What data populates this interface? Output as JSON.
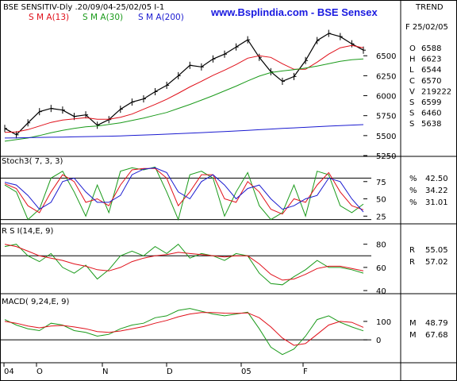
{
  "header": {
    "title": "BSE SENSITIV-Dly .20/09/04-25/02/05  I-1",
    "site": "www.Bsplindia.com - BSE Sensex",
    "trend_label": "TREND",
    "sma_labels": [
      "S M A(13)",
      "S M A(30)",
      "S M A(200)"
    ],
    "sma_colors": [
      "#e0101a",
      "#1a9a1a",
      "#1a1ad0"
    ]
  },
  "info_panel": {
    "date": "F 25/02/05",
    "rows": [
      {
        "key": "O",
        "value": "6588",
        "color": "#000000"
      },
      {
        "key": "H",
        "value": "6623",
        "color": "#9a8a00"
      },
      {
        "key": "L",
        "value": "6544",
        "color": "#9a8a00"
      },
      {
        "key": "C",
        "value": "6570",
        "color": "#9a8a00"
      },
      {
        "key": "V",
        "value": "219222",
        "color": "#000000"
      },
      {
        "key": "S",
        "value": "6599",
        "color": "#e0101a"
      },
      {
        "key": "S",
        "value": "6460",
        "color": "#1a9a1a"
      },
      {
        "key": "S",
        "value": "5638",
        "color": "#1a1ad0"
      }
    ]
  },
  "stoch_panel": {
    "label": "Stoch3( 7, 3, 3)",
    "readings": [
      {
        "key": "%",
        "value": "42.50",
        "color": "#1a9a1a"
      },
      {
        "key": "%",
        "value": "34.22",
        "color": "#e0101a"
      },
      {
        "key": "%",
        "value": "31.01",
        "color": "#1a1ad0"
      }
    ]
  },
  "rsi_panel": {
    "label": "R S I(14,E, 9)",
    "readings": [
      {
        "key": "R",
        "value": "55.05",
        "color": "#1a9a1a"
      },
      {
        "key": "R",
        "value": "57.02",
        "color": "#e0101a"
      }
    ]
  },
  "macd_panel": {
    "label": "MACD( 9,24,E, 9)",
    "readings": [
      {
        "key": "M",
        "value": "48.79",
        "color": "#1a9a1a"
      },
      {
        "key": "M",
        "value": "67.68",
        "color": "#e0101a"
      }
    ]
  },
  "x_axis": {
    "labels": [
      "04",
      "O",
      "N",
      "D",
      "05",
      "F"
    ]
  },
  "chart_data": [
    {
      "type": "line",
      "name": "price",
      "title": "BSE SENSITIV-Dly .20/09/04-25/02/05  I-1",
      "ylim": [
        5250,
        6900
      ],
      "y_ticks": [
        5250,
        5500,
        5750,
        6000,
        6250,
        6500
      ],
      "x": [
        "Sep-20",
        "Sep-24",
        "Sep-29",
        "Oct-04",
        "Oct-08",
        "Oct-14",
        "Oct-19",
        "Oct-25",
        "Oct-29",
        "Nov-03",
        "Nov-09",
        "Nov-15",
        "Nov-19",
        "Nov-25",
        "Nov-30",
        "Dec-06",
        "Dec-10",
        "Dec-16",
        "Dec-21",
        "Dec-27",
        "Dec-31",
        "Jan-05",
        "Jan-10",
        "Jan-14",
        "Jan-19",
        "Jan-24",
        "Jan-28",
        "Feb-02",
        "Feb-08",
        "Feb-14",
        "Feb-18",
        "Feb-25"
      ],
      "series": [
        {
          "name": "close",
          "color": "#000000",
          "values": [
            5590,
            5510,
            5660,
            5800,
            5840,
            5820,
            5740,
            5760,
            5630,
            5700,
            5830,
            5920,
            5960,
            6050,
            6130,
            6250,
            6380,
            6360,
            6460,
            6520,
            6610,
            6700,
            6480,
            6300,
            6180,
            6240,
            6440,
            6690,
            6780,
            6740,
            6650,
            6570
          ]
        },
        {
          "name": "S M A(13)",
          "color": "#e0101a",
          "values": [
            5540,
            5545,
            5575,
            5620,
            5665,
            5695,
            5710,
            5725,
            5705,
            5705,
            5730,
            5770,
            5830,
            5890,
            5955,
            6030,
            6110,
            6180,
            6255,
            6320,
            6390,
            6470,
            6500,
            6480,
            6400,
            6330,
            6330,
            6420,
            6520,
            6600,
            6630,
            6599
          ]
        },
        {
          "name": "S M A(30)",
          "color": "#1a9a1a",
          "values": [
            5430,
            5450,
            5470,
            5500,
            5535,
            5565,
            5590,
            5610,
            5620,
            5640,
            5660,
            5690,
            5720,
            5755,
            5790,
            5840,
            5890,
            5945,
            6000,
            6060,
            6120,
            6185,
            6245,
            6290,
            6310,
            6325,
            6345,
            6370,
            6400,
            6430,
            6450,
            6460
          ]
        },
        {
          "name": "S M A(200)",
          "color": "#1a1ad0",
          "values": [
            5470,
            5472,
            5475,
            5478,
            5480,
            5482,
            5485,
            5488,
            5490,
            5493,
            5497,
            5502,
            5507,
            5512,
            5518,
            5524,
            5530,
            5537,
            5544,
            5551,
            5558,
            5566,
            5574,
            5582,
            5590,
            5597,
            5604,
            5612,
            5619,
            5626,
            5632,
            5638
          ]
        }
      ]
    },
    {
      "type": "line",
      "name": "stochastic",
      "ylim": [
        15,
        100
      ],
      "y_ticks": [
        25,
        50,
        75
      ],
      "hlines": [
        20,
        80
      ],
      "series": [
        {
          "name": "%K",
          "color": "#1a9a1a",
          "values": [
            70,
            60,
            20,
            35,
            80,
            90,
            60,
            25,
            70,
            30,
            90,
            95,
            92,
            96,
            60,
            20,
            85,
            90,
            80,
            25,
            60,
            88,
            40,
            20,
            30,
            70,
            25,
            90,
            85,
            40,
            30,
            42.5
          ]
        },
        {
          "name": "%D",
          "color": "#e0101a",
          "values": [
            72,
            65,
            40,
            30,
            60,
            85,
            75,
            45,
            50,
            40,
            70,
            92,
            94,
            94,
            80,
            40,
            60,
            85,
            85,
            50,
            45,
            75,
            60,
            35,
            28,
            50,
            45,
            70,
            88,
            60,
            40,
            34.22
          ]
        },
        {
          "name": "slow",
          "color": "#1a1ad0",
          "values": [
            74,
            70,
            55,
            35,
            45,
            75,
            80,
            60,
            45,
            45,
            55,
            85,
            93,
            95,
            88,
            60,
            50,
            75,
            85,
            70,
            50,
            65,
            70,
            50,
            35,
            40,
            50,
            55,
            80,
            75,
            50,
            31.01
          ]
        }
      ]
    },
    {
      "type": "line",
      "name": "rsi",
      "ylim": [
        38,
        88
      ],
      "y_ticks": [
        40,
        60,
        80
      ],
      "hlines": [
        70
      ],
      "series": [
        {
          "name": "RSI",
          "color": "#1a9a1a",
          "values": [
            78,
            80,
            70,
            65,
            72,
            60,
            55,
            62,
            50,
            58,
            70,
            74,
            70,
            78,
            72,
            80,
            68,
            72,
            70,
            66,
            72,
            70,
            55,
            46,
            45,
            52,
            58,
            66,
            60,
            60,
            58,
            55.05
          ]
        },
        {
          "name": "signal",
          "color": "#e0101a",
          "values": [
            80,
            78,
            74,
            70,
            68,
            66,
            63,
            61,
            58,
            57,
            60,
            65,
            68,
            70,
            71,
            73,
            72,
            71,
            70,
            69,
            70,
            70,
            63,
            54,
            49,
            50,
            54,
            59,
            61,
            61,
            59,
            57.02
          ]
        }
      ]
    },
    {
      "type": "line",
      "name": "macd",
      "ylim": [
        -120,
        190
      ],
      "y_ticks": [
        0,
        100
      ],
      "hlines": [
        0
      ],
      "series": [
        {
          "name": "MACD",
          "color": "#1a9a1a",
          "values": [
            110,
            80,
            60,
            50,
            90,
            80,
            50,
            40,
            20,
            30,
            60,
            80,
            90,
            120,
            130,
            160,
            170,
            155,
            140,
            130,
            140,
            150,
            60,
            -40,
            -80,
            -50,
            20,
            110,
            130,
            95,
            70,
            48.79
          ]
        },
        {
          "name": "signal",
          "color": "#e0101a",
          "values": [
            100,
            90,
            75,
            65,
            75,
            78,
            70,
            60,
            45,
            40,
            48,
            60,
            72,
            90,
            105,
            125,
            140,
            148,
            148,
            145,
            144,
            146,
            120,
            70,
            10,
            -30,
            -20,
            30,
            80,
            100,
            95,
            67.68
          ]
        }
      ]
    }
  ]
}
